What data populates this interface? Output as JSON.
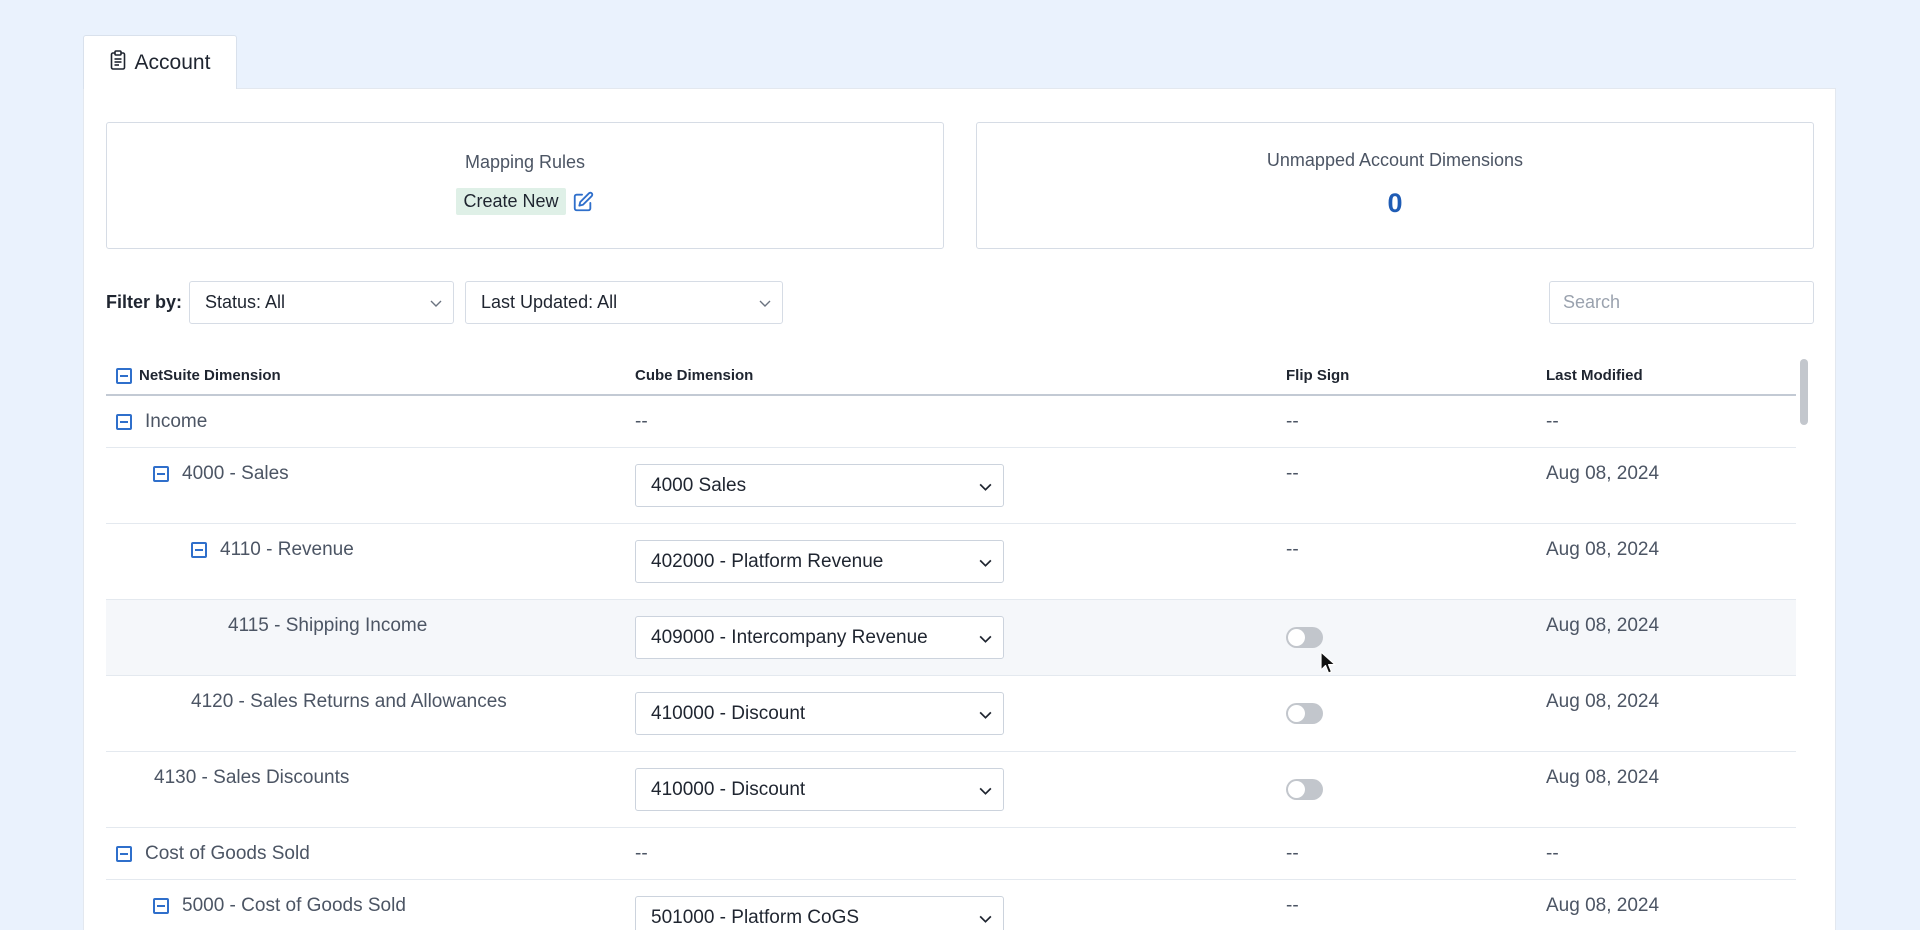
{
  "tab": {
    "label": "Account",
    "icon": "clipboard-icon"
  },
  "cards": {
    "mapping_rules": {
      "title": "Mapping Rules",
      "create_label": "Create New",
      "icon": "edit-icon"
    },
    "unmapped": {
      "title": "Unmapped Account Dimensions",
      "count": "0"
    }
  },
  "filters": {
    "label": "Filter by:",
    "status": "Status: All",
    "last_updated": "Last Updated: All",
    "search_placeholder": "Search"
  },
  "table": {
    "headers": {
      "netsuite": "NetSuite Dimension",
      "cube": "Cube Dimension",
      "flip": "Flip Sign",
      "modified": "Last Modified"
    },
    "rows": [
      {
        "netsuite": "Income",
        "collapsible": true,
        "cube": "--",
        "flip": "--",
        "modified": "--"
      },
      {
        "netsuite": "4000 - Sales",
        "collapsible": true,
        "cube": "4000 Sales",
        "flip": "--",
        "modified": "Aug 08, 2024"
      },
      {
        "netsuite": "4110 - Revenue",
        "collapsible": true,
        "cube": "402000 - Platform Revenue",
        "flip": "--",
        "modified": "Aug 08, 2024"
      },
      {
        "netsuite": "4115 - Shipping Income",
        "collapsible": false,
        "cube": "409000 - Intercompany Revenue",
        "flip": "off",
        "modified": "Aug 08, 2024"
      },
      {
        "netsuite": "4120 - Sales Returns and Allowances",
        "collapsible": false,
        "cube": "410000 - Discount",
        "flip": "off",
        "modified": "Aug 08, 2024"
      },
      {
        "netsuite": "4130 - Sales Discounts",
        "collapsible": false,
        "cube": "410000 - Discount",
        "flip": "off",
        "modified": "Aug 08, 2024"
      },
      {
        "netsuite": "Cost of Goods Sold",
        "collapsible": true,
        "cube": "--",
        "flip": "--",
        "modified": "--"
      },
      {
        "netsuite": "5000 - Cost of Goods Sold",
        "collapsible": true,
        "cube": "501000 - Platform CoGS",
        "flip": "--",
        "modified": "Aug 08, 2024"
      }
    ]
  },
  "colors": {
    "accent": "#1f5cb5",
    "background": "#eaf2fd",
    "create_bg": "#dff0e7"
  }
}
